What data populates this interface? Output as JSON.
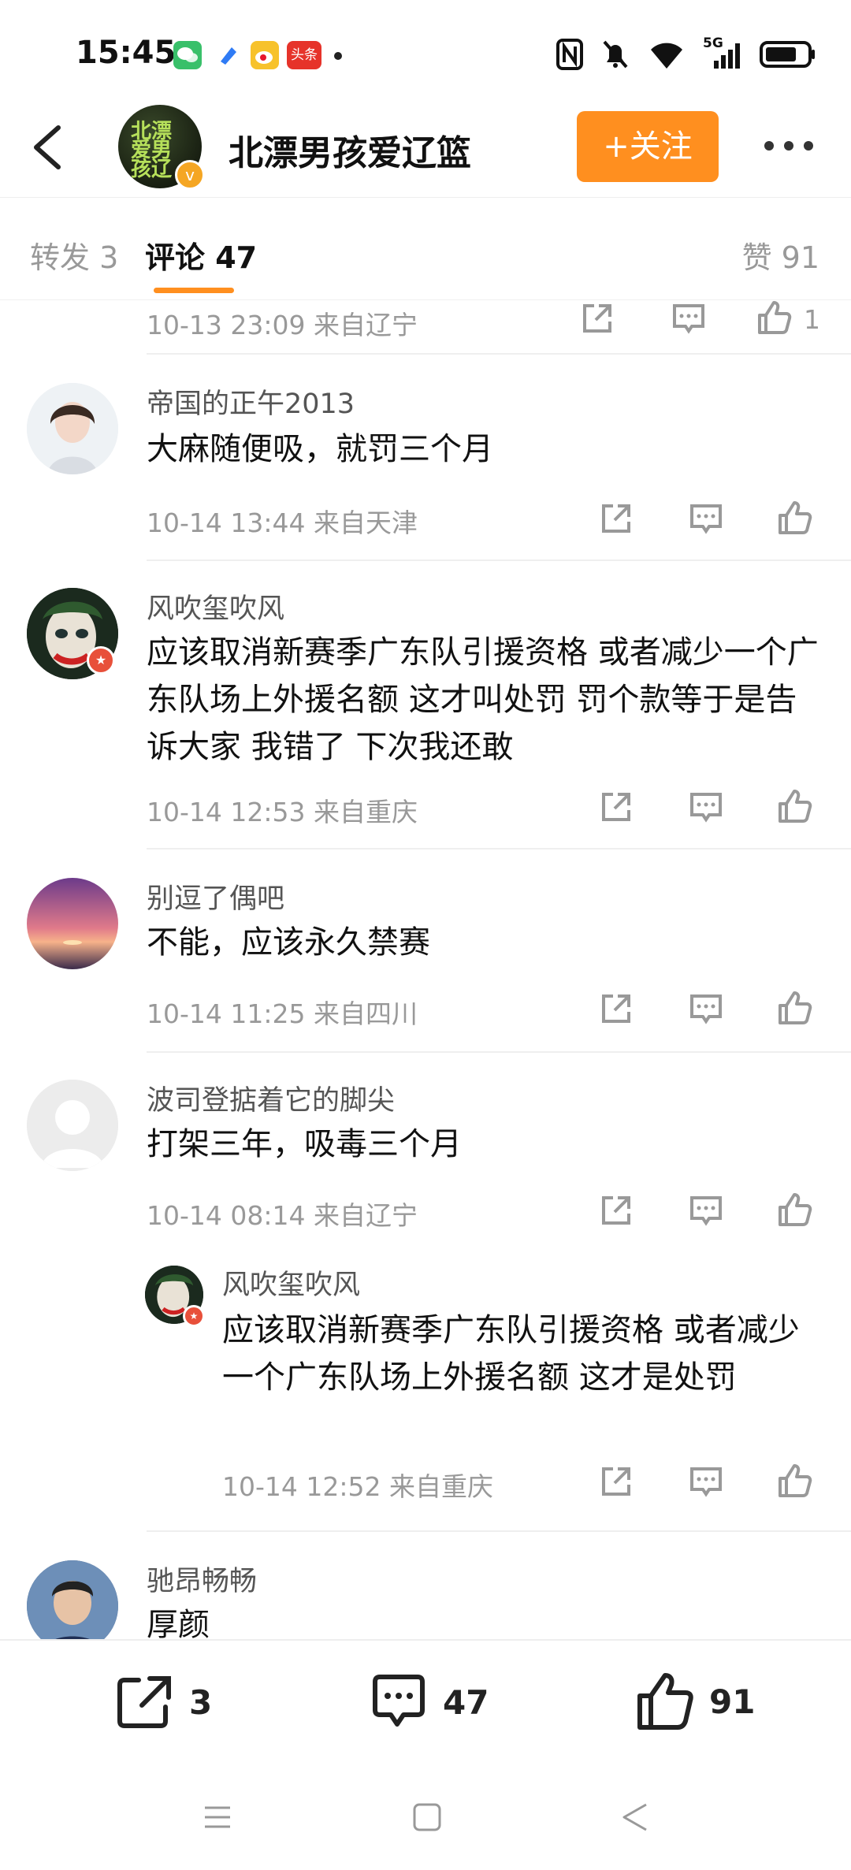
{
  "status_bar": {
    "time": "15:45",
    "signal": "5G",
    "app_icons": [
      "wechat-icon",
      "blue-app-icon",
      "weibo-icon",
      "toutiao-icon"
    ],
    "toutiao_label": "头条"
  },
  "header": {
    "title": "北漂男孩爱辽篮",
    "follow_label": "+关注",
    "avatar_glyphs": "北漂爱男孩辽",
    "accent": "#ff8f1f"
  },
  "tabs": {
    "repost": "转发 3",
    "comments": "评论 47",
    "likes": "赞 91"
  },
  "comments": [
    {
      "time": "10-13 23:09",
      "location": "来自辽宁",
      "likes": "1"
    },
    {
      "user": "帝国的正午2013",
      "text": "大麻随便吸，就罚三个月",
      "time": "10-14 13:44",
      "location": "来自天津"
    },
    {
      "user": "风吹玺吹风",
      "text": "应该取消新赛季广东队引援资格 或者减少一个广东队场上外援名额 这才叫处罚 罚个款等于是告诉大家 我错了 下次我还敢",
      "time": "10-14 12:53",
      "location": "来自重庆"
    },
    {
      "user": "别逗了偶吧",
      "text": "不能，应该永久禁赛",
      "time": "10-14 11:25",
      "location": "来自四川"
    },
    {
      "user": "波司登掂着它的脚尖",
      "text": "打架三年，吸毒三个月",
      "time": "10-14 08:14",
      "location": "来自辽宁"
    },
    {
      "user": "风吹玺吹风",
      "text": "应该取消新赛季广东队引援资格 或者减少一个广东队场上外援名额 这才是处罚",
      "time": "10-14 12:52",
      "location": "来自重庆"
    },
    {
      "user": "驰昂畅畅",
      "text": "厚颜"
    }
  ],
  "bottom_bar": {
    "reposts": "3",
    "comments": "47",
    "likes": "91"
  }
}
